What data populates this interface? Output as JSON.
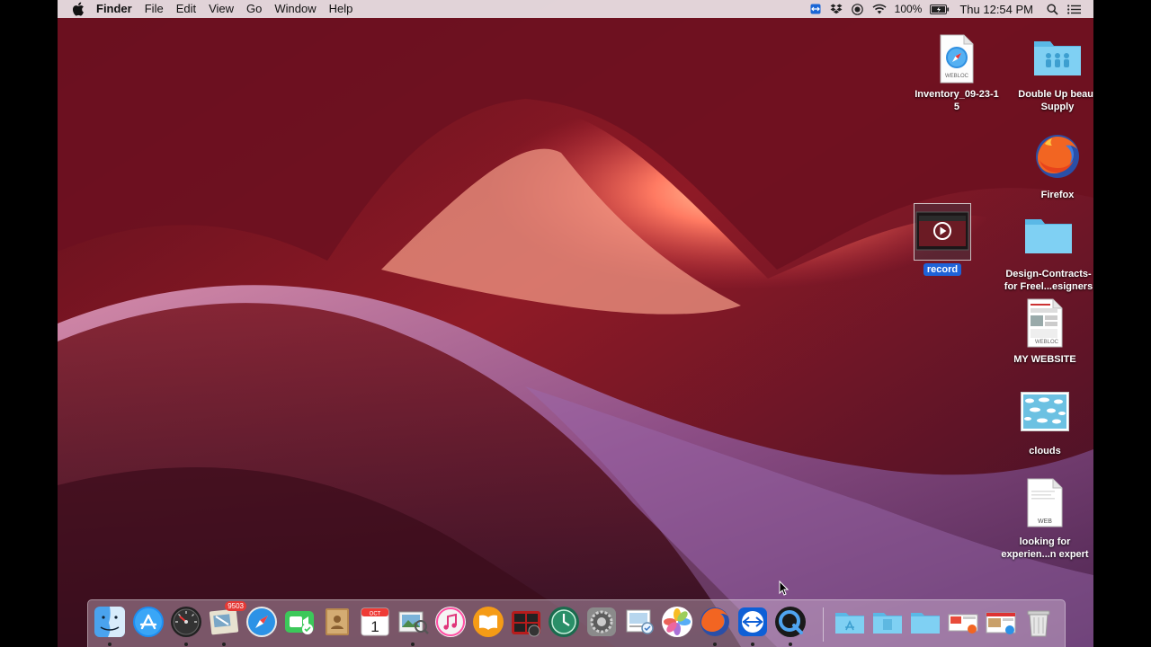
{
  "menubar": {
    "app_name": "Finder",
    "menus": [
      "File",
      "Edit",
      "View",
      "Go",
      "Window",
      "Help"
    ],
    "battery_text": "100%",
    "clock": "Thu 12:54 PM"
  },
  "desktop": {
    "icons": [
      {
        "label": "Inventory_09-23-1\n5",
        "badge_text": "WEBLOC"
      },
      {
        "label": "Double Up beaut\nSupply"
      },
      {
        "label": "Firefox"
      },
      {
        "label": "record"
      },
      {
        "label": "Design-Contracts-\nfor Freel...esigners"
      },
      {
        "label": "MY WEBSITE",
        "badge_text": "WEBLOC"
      },
      {
        "label": "clouds"
      },
      {
        "label": "looking for\nexperien...n expert",
        "badge_text": "WEB"
      }
    ]
  },
  "dock": {
    "items": [
      "Finder",
      "App Store",
      "Dashboard",
      "Mail",
      "Safari",
      "FaceTime",
      "Contacts",
      "Calendar",
      "Preview",
      "iTunes",
      "iBooks",
      "Photo Booth",
      "Time Machine",
      "System Preferences",
      "Photos",
      "Firefox",
      "TeamViewer",
      "QuickTime Player",
      "Applications",
      "Documents",
      "Downloads",
      "Trash"
    ],
    "mail_badge": "9503",
    "calendar_month": "OCT",
    "calendar_day": "1"
  },
  "colors": {
    "menubar_bg": "#ece4e8",
    "selection_blue": "#1e63d8",
    "folder_blue": "#6ec9f0"
  }
}
